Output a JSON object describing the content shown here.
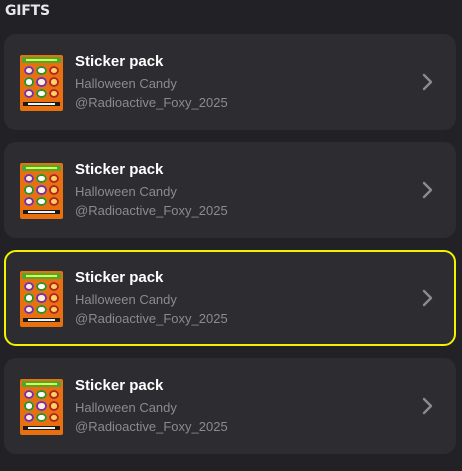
{
  "section": {
    "title": "GIFTS"
  },
  "gifts": [
    {
      "title": "Sticker pack",
      "subtitle": "Halloween Candy",
      "username": "@Radioactive_Foxy_2025",
      "thumbnail_icon": "halloween-candy-sticker-pack",
      "selected": false
    },
    {
      "title": "Sticker pack",
      "subtitle": "Halloween Candy",
      "username": "@Radioactive_Foxy_2025",
      "thumbnail_icon": "halloween-candy-sticker-pack",
      "selected": false
    },
    {
      "title": "Sticker pack",
      "subtitle": "Halloween Candy",
      "username": "@Radioactive_Foxy_2025",
      "thumbnail_icon": "halloween-candy-sticker-pack",
      "selected": true
    },
    {
      "title": "Sticker pack",
      "subtitle": "Halloween Candy",
      "username": "@Radioactive_Foxy_2025",
      "thumbnail_icon": "halloween-candy-sticker-pack",
      "selected": false
    }
  ],
  "icons": {
    "chevron": "chevron-right-icon"
  },
  "colors": {
    "background": "#222226",
    "card": "#2c2c31",
    "selection_border": "#f2f200",
    "secondary_text": "#8a8a91"
  }
}
